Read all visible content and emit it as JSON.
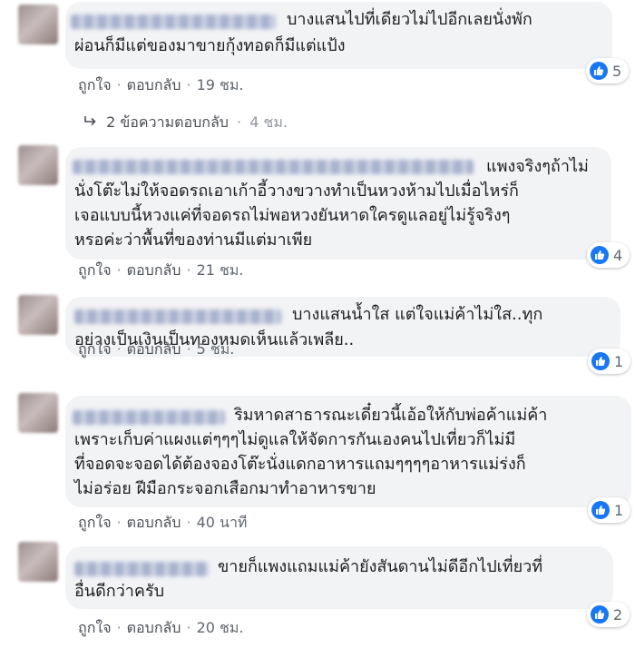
{
  "labels": {
    "like": "ถูกใจ",
    "reply": "ตอบกลับ",
    "dot": "·"
  },
  "comments": [
    {
      "lines": [
        "บางแสนไปที่เดียวไม่ไปอีกเลยนั่งพัก",
        "ผ่อนก็มีแต่ของมาขายกุ้งทอดก็มีแต่แป้ง"
      ],
      "time": "19 ชม.",
      "likes": "5",
      "replies": {
        "label": "2 ข้อความตอบกลับ",
        "time": "4 ชม."
      }
    },
    {
      "lines": [
        "แพงจริงๆถ้าไม่",
        "นั่งโต๊ะไม่ให้จอดรถเอาเก้าอี้วางขวางทำเป็นหวงห้ามไปเมื่อไหร่ก็",
        "เจอแบบนี้หวงแค่ที่จอดรถไม่พอหวงยันหาดใครดูแลอยู่ไม่รู้จริงๆ",
        "หรอค่ะว่าพื้นที่ของท่านมีแต่มาเพีย"
      ],
      "time": "21 ชม.",
      "likes": "4"
    },
    {
      "lines": [
        "บางแสนน้ำใส แต่ใจแม่ค้าไม่ใส..ทุก",
        "อย่างเป็นเงินเป็นทองหมดเห็นแล้วเพลีย.."
      ],
      "time": "5 ชม.",
      "likes": "1"
    },
    {
      "lines": [
        "ริมหาดสาธารณะเดี๋ยวนี้เอ้อให้กับพ่อค้าแม่ค้า",
        "เพราะเก็บค่าแผงแต่ๆๆๆไม่ดูแลให้จัดการกันเองคนไปเที่ยวก็ไม่มี",
        "ที่จอดจะจอดได้ต้องจองโต๊ะนั่งแดกอาหารแถมๆๆๆๆอาหารแม่ร่งก็",
        "ไม่อร่อย ฝีมือกระจอกเสือกมาทำอาหารขาย"
      ],
      "time": "40 นาที",
      "likes": "1"
    },
    {
      "lines": [
        "ขายก็แพงแถมแม่ค้ายังสันดานไม่ดีอีกไปเที่ยวที่",
        "อื่นดีกว่าครับ"
      ],
      "time": "20 ชม.",
      "likes": "2"
    }
  ],
  "colors": {
    "like": "#1877f2",
    "bubble": "#f2f3f5",
    "meta": "#606770"
  },
  "icons": [
    "thumbs-up-icon",
    "reply-arrow-icon"
  ]
}
